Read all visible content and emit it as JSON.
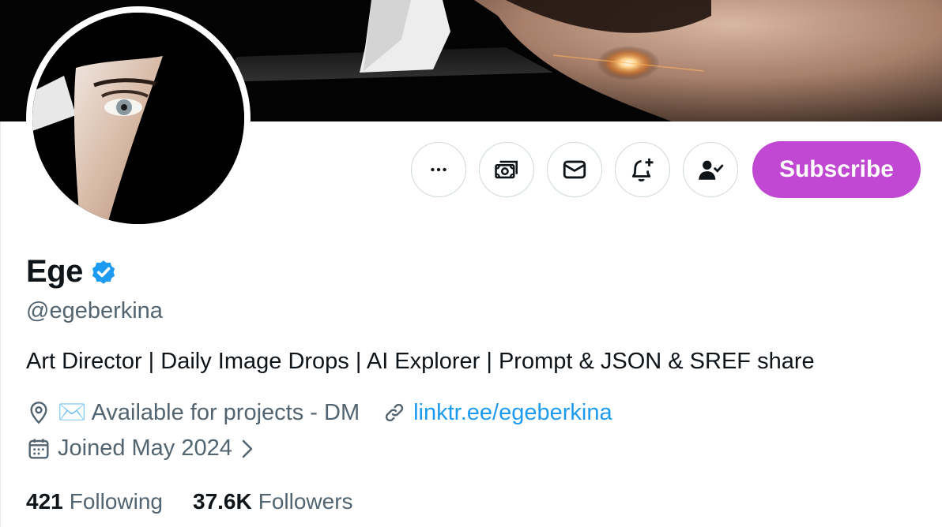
{
  "profile": {
    "display_name": "Ege",
    "verified": true,
    "handle": "@egeberkina",
    "bio": "Art Director | Daily Image Drops | AI Explorer | Prompt & JSON & SREF share",
    "location": "✉️ Available for projects - DM",
    "website": "linktr.ee/egeberkina",
    "joined": "Joined May 2024",
    "following_count": "421",
    "following_label": "Following",
    "followers_count": "37.6K",
    "followers_label": "Followers"
  },
  "actions": {
    "more_icon": "more-icon",
    "tip_icon": "money-icon",
    "message_icon": "envelope-icon",
    "notify_icon": "bell-plus-icon",
    "following_icon": "person-check-icon",
    "subscribe_label": "Subscribe"
  },
  "colors": {
    "subscribe": "#c048d2",
    "link": "#1d9bf0",
    "verified_badge": "#1d9bf0",
    "secondary_text": "#536471"
  }
}
